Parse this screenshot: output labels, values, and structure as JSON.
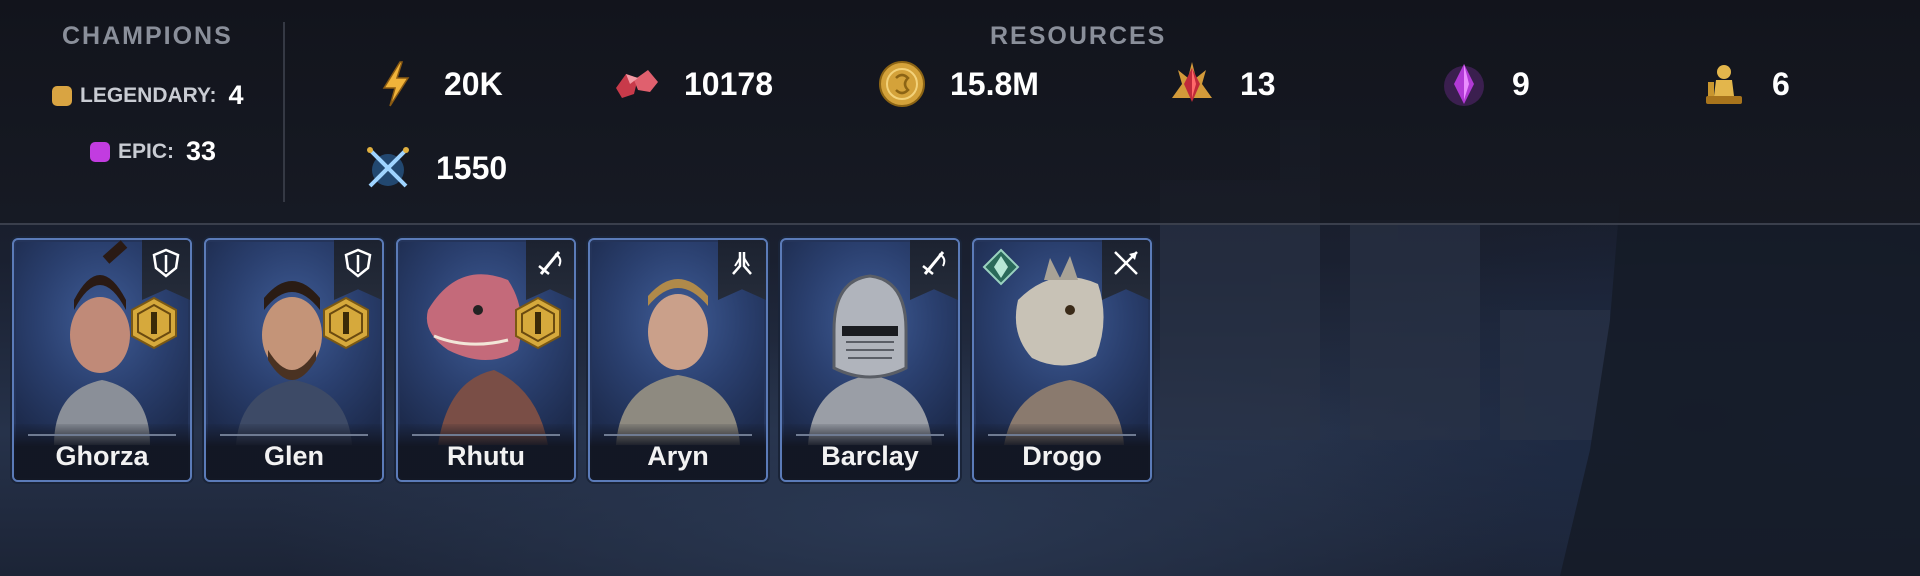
{
  "champions": {
    "heading": "CHAMPIONS",
    "legendary": {
      "label": "LEGENDARY:",
      "count": "4",
      "color": "#d9a442"
    },
    "epic": {
      "label": "EPIC:",
      "count": "33",
      "color": "#c23ce0"
    }
  },
  "resources": {
    "heading": "RESOURCES",
    "items": [
      {
        "icon": "energy-icon",
        "value": "20K"
      },
      {
        "icon": "rubies-icon",
        "value": "10178"
      },
      {
        "icon": "gold-coin-icon",
        "value": "15.8M"
      },
      {
        "icon": "red-crystal-icon",
        "value": "13"
      },
      {
        "icon": "purple-crystal-icon",
        "value": "9"
      },
      {
        "icon": "gold-figurine-icon",
        "value": "6"
      },
      {
        "icon": "crossed-swords-icon",
        "value": "1550"
      }
    ]
  },
  "roster": [
    {
      "name": "Ghorza",
      "class_icon": "defense-shield-icon",
      "rank": "I"
    },
    {
      "name": "Glen",
      "class_icon": "defense-shield-icon",
      "rank": "I"
    },
    {
      "name": "Rhutu",
      "class_icon": "attack-sword-icon",
      "rank": "I"
    },
    {
      "name": "Aryn",
      "class_icon": "support-hands-icon"
    },
    {
      "name": "Barclay",
      "class_icon": "attack-sword-icon"
    },
    {
      "name": "Drogo",
      "class_icon": "ranged-crossbow-icon",
      "faction_icon": "faction-emblem-icon"
    }
  ],
  "colors": {
    "card_border": "#5b7bb8",
    "gold_badge": "#d6a93c",
    "accent_blue": "#3f5c96"
  }
}
